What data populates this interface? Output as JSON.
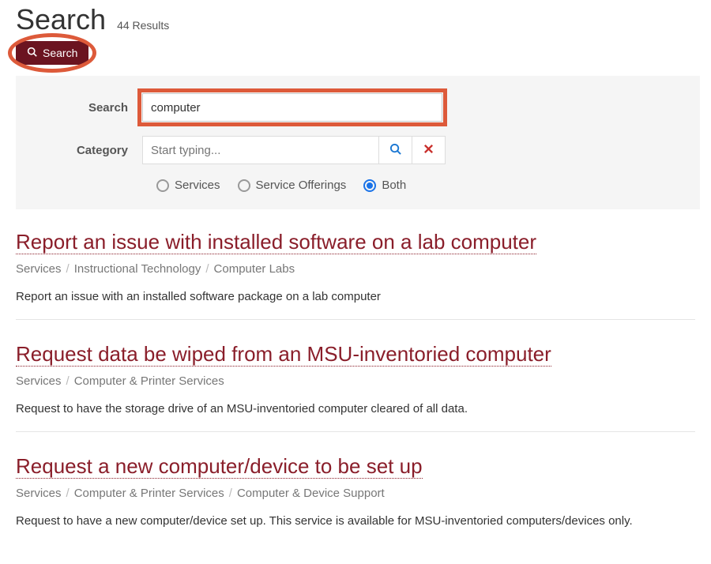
{
  "header": {
    "title": "Search",
    "results_count": "44 Results"
  },
  "search_button": {
    "label": "Search"
  },
  "filters": {
    "search_label": "Search",
    "search_value": "computer",
    "category_label": "Category",
    "category_placeholder": "Start typing...",
    "radios": {
      "services": "Services",
      "offerings": "Service Offerings",
      "both": "Both",
      "selected": "both"
    }
  },
  "results": [
    {
      "title": "Report an issue with installed software on a lab computer",
      "breadcrumb": [
        "Services",
        "Instructional Technology",
        "Computer Labs"
      ],
      "description": "Report an issue with an installed software package on a lab computer"
    },
    {
      "title": "Request data be wiped from an MSU-inventoried computer",
      "breadcrumb": [
        "Services",
        "Computer & Printer Services"
      ],
      "description": "Request to have the storage drive of an MSU-inventoried computer cleared of all data."
    },
    {
      "title": "Request a new computer/device to be set up",
      "breadcrumb": [
        "Services",
        "Computer & Printer Services",
        "Computer & Device Support"
      ],
      "description": "Request to have a new computer/device set up. This service is available for MSU-inventoried computers/devices only."
    }
  ],
  "colors": {
    "brand": "#6b1420",
    "link": "#8a1e2a",
    "annotation": "#dd5a3a",
    "radio_selected": "#1a73e8"
  }
}
